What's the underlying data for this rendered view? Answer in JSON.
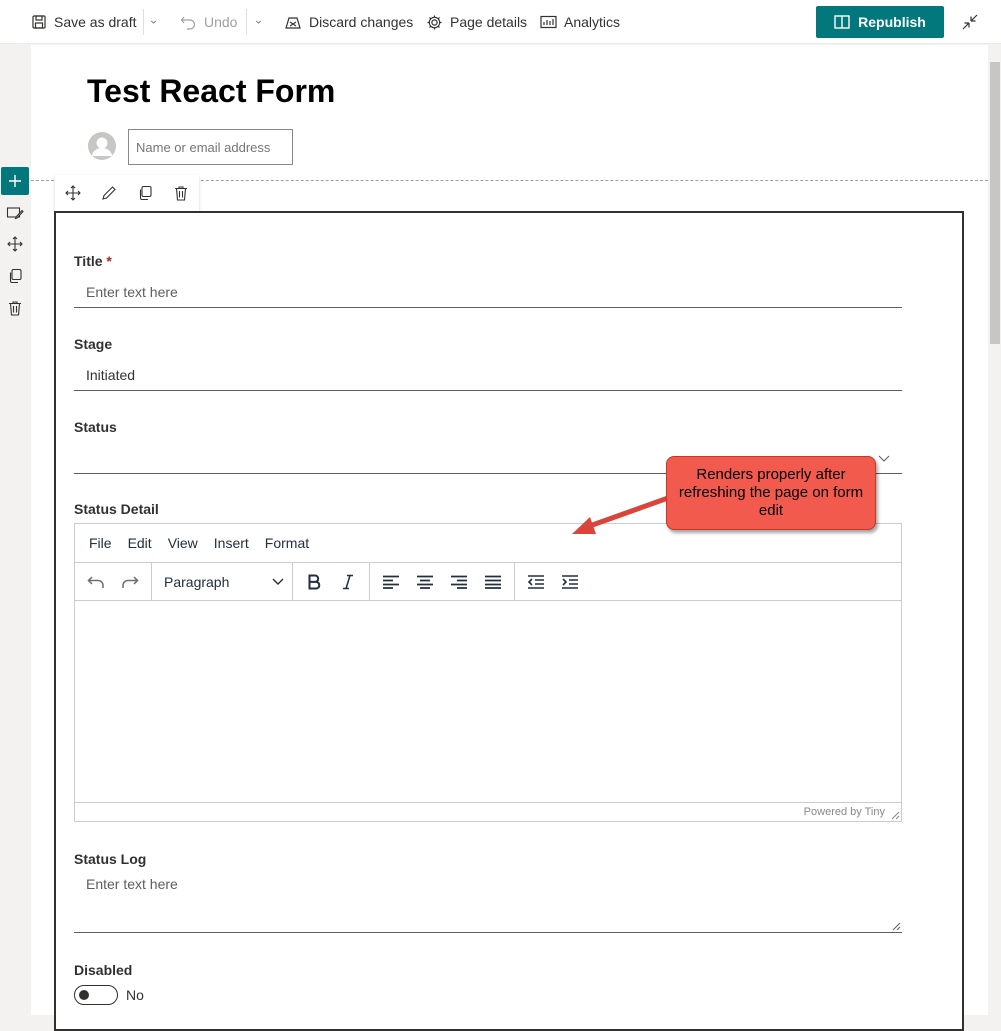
{
  "commandbar": {
    "save_draft": "Save as draft",
    "undo": "Undo",
    "discard": "Discard changes",
    "page_details": "Page details",
    "analytics": "Analytics",
    "republish": "Republish"
  },
  "page": {
    "title": "Test React Form",
    "author_placeholder": "Name or email address"
  },
  "form": {
    "title_label": "Title",
    "required_mark": "*",
    "title_placeholder": "Enter text here",
    "stage_label": "Stage",
    "stage_value": "Initiated",
    "status_label": "Status",
    "status_detail_label": "Status Detail",
    "status_log_label": "Status Log",
    "status_log_placeholder": "Enter text here",
    "disabled_label": "Disabled",
    "disabled_value": "No"
  },
  "editor": {
    "menu": [
      "File",
      "Edit",
      "View",
      "Insert",
      "Format"
    ],
    "block_format": "Paragraph",
    "powered_by": "Powered by Tiny"
  },
  "annotation": {
    "text": "Renders properly after refreshing the page on form edit"
  },
  "colors": {
    "accent": "#03787c",
    "callout": "#f25a4e"
  }
}
